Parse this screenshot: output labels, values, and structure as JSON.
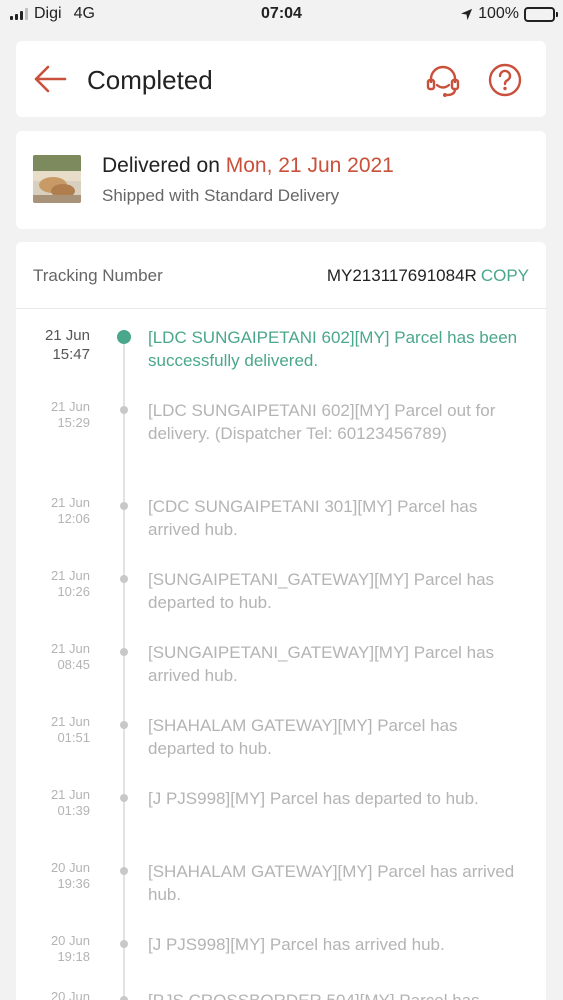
{
  "status_bar": {
    "carrier": "Digi",
    "network": "4G",
    "time": "07:04",
    "battery": "100%",
    "battery_level": 1.0
  },
  "header": {
    "title": "Completed",
    "back_icon": "arrow-left-icon",
    "support_icon": "headset-icon",
    "help_icon": "question-circle-icon",
    "accent": "#c9503a"
  },
  "delivery": {
    "delivered_prefix": "Delivered on ",
    "delivered_date": "Mon, 21 Jun 2021",
    "shipping_method": "Shipped with Standard Delivery"
  },
  "tracking": {
    "label": "Tracking Number",
    "number": "MY213117691084R",
    "copy_label": "COPY",
    "accent": "#4aa78b",
    "events": [
      {
        "day": "21 Jun",
        "time": "15:47",
        "text": "[LDC SUNGAIPETANI 602][MY] Parcel has been successfully delivered.",
        "active": true
      },
      {
        "day": "21 Jun",
        "time": "15:29",
        "text": "[LDC SUNGAIPETANI 602][MY] Parcel out for delivery. (Dispatcher Tel: 60123456789)"
      },
      {
        "day": "21 Jun",
        "time": "12:06",
        "text": "[CDC SUNGAIPETANI 301][MY] Parcel has arrived hub."
      },
      {
        "day": "21 Jun",
        "time": "10:26",
        "text": "[SUNGAIPETANI_GATEWAY][MY] Parcel has departed to hub."
      },
      {
        "day": "21 Jun",
        "time": "08:45",
        "text": "[SUNGAIPETANI_GATEWAY][MY] Parcel has arrived hub."
      },
      {
        "day": "21 Jun",
        "time": "01:51",
        "text": "[SHAHALAM GATEWAY][MY] Parcel has departed to hub."
      },
      {
        "day": "21 Jun",
        "time": "01:39",
        "text": "[J PJS998][MY] Parcel has departed to hub."
      },
      {
        "day": "20 Jun",
        "time": "19:36",
        "text": "[SHAHALAM GATEWAY][MY] Parcel has arrived hub."
      },
      {
        "day": "20 Jun",
        "time": "19:18",
        "text": "[J PJS998][MY] Parcel has arrived hub."
      },
      {
        "day": "20 Jun",
        "time": "",
        "text": "[PJS CROSSBORDER 504][MY] Parcel has"
      }
    ]
  }
}
